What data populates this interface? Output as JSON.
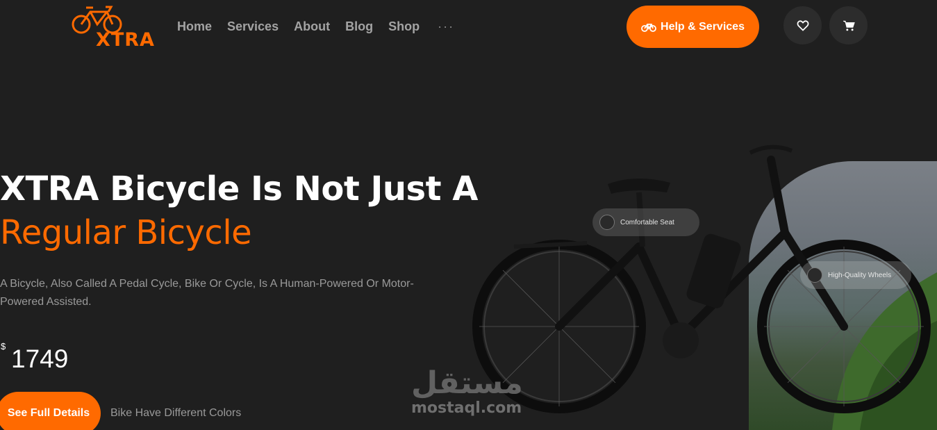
{
  "brand": {
    "logo_text": "XTRA",
    "accent_color": "#ff6a00"
  },
  "nav": {
    "items": [
      "Home",
      "Services",
      "About",
      "Blog",
      "Shop"
    ],
    "more_label": "···"
  },
  "header": {
    "help_label": "Help & Services",
    "help_icon": "bicycle-icon",
    "favorite_icon": "heart-icon",
    "cart_icon": "cart-icon"
  },
  "hero": {
    "title_line1": "XTRA Bicycle Is Not Just A",
    "title_line2": "Regular Bicycle",
    "description": "A Bicycle, Also Called A Pedal Cycle, Bike Or Cycle, Is A Human-Powered Or Motor-Powered Assisted.",
    "currency": "$",
    "price": "1749",
    "details_label": "See Full Details",
    "colors_note": "Bike Have Different Colors"
  },
  "product": {
    "tag_seat": "Comfortable Seat",
    "tag_wheels": "High-Quality Wheels"
  },
  "watermark": {
    "arabic": "مستقل",
    "latin": "mostaql.com"
  }
}
